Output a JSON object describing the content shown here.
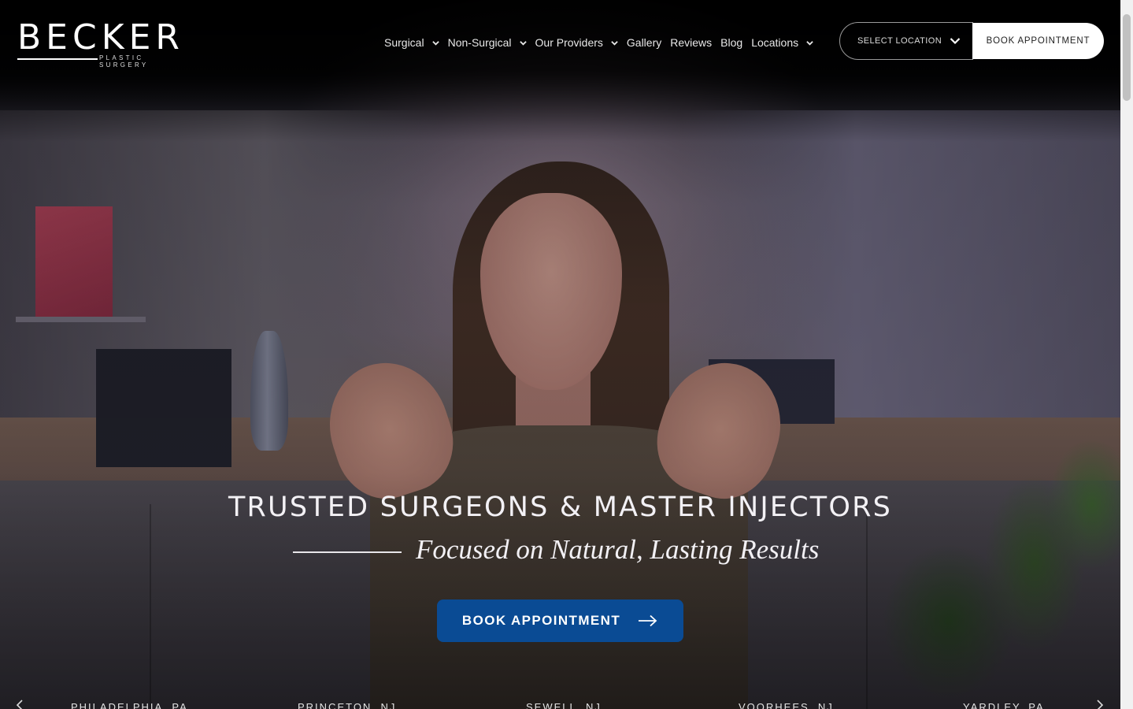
{
  "brand": {
    "logo_text": "BECKER",
    "logo_subtext": "PLASTIC SURGERY"
  },
  "nav": {
    "items": [
      {
        "label": "Surgical",
        "has_dropdown": true
      },
      {
        "label": "Non-Surgical",
        "has_dropdown": true
      },
      {
        "label": "Our Providers",
        "has_dropdown": true
      },
      {
        "label": "Gallery",
        "has_dropdown": false
      },
      {
        "label": "Reviews",
        "has_dropdown": false
      },
      {
        "label": "Blog",
        "has_dropdown": false
      },
      {
        "label": "Locations",
        "has_dropdown": true
      }
    ],
    "select_location": "SELECT LOCATION",
    "book_appointment": "BOOK APPOINTMENT"
  },
  "hero": {
    "headline": "TRUSTED SURGEONS & MASTER INJECTORS",
    "subheadline": "Focused on Natural, Lasting Results",
    "cta_label": "BOOK APPOINTMENT"
  },
  "locations": [
    "PHILADELPHIA, PA",
    "PRINCETON, NJ",
    "SEWELL, NJ",
    "VOORHEES, NJ",
    "YARDLEY, PA"
  ],
  "colors": {
    "cta_blue": "#0a4b94",
    "header_bg": "#000000",
    "book_button_bg": "#ffffff"
  },
  "icons": {
    "dropdown": "chevron-down-icon",
    "cta_arrow": "arrow-right-icon",
    "carousel_prev": "chevron-left-icon",
    "carousel_next": "chevron-right-icon"
  }
}
